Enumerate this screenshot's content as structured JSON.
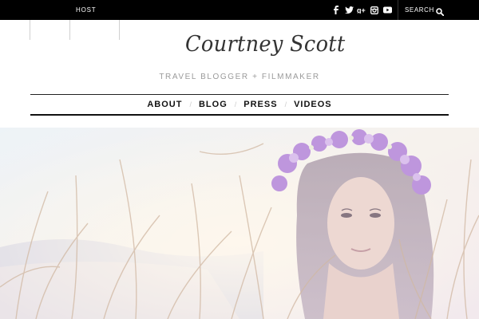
{
  "topbar": {
    "host_label": "HOST",
    "social": [
      "facebook-icon",
      "twitter-icon",
      "google-plus-icon",
      "instagram-icon",
      "youtube-icon"
    ],
    "search_placeholder": "SEARCH"
  },
  "header": {
    "logo_text": "Courtney Scott",
    "tagline": "TRAVEL BLOGGER + FILMMAKER"
  },
  "nav": {
    "items": [
      {
        "label": "ABOUT"
      },
      {
        "label": "BLOG"
      },
      {
        "label": "PRESS"
      },
      {
        "label": "VIDEOS"
      }
    ]
  },
  "colors": {
    "topbar_bg": "#000000",
    "tagline": "#9a9a9a",
    "flowers": "#b07fd6"
  }
}
